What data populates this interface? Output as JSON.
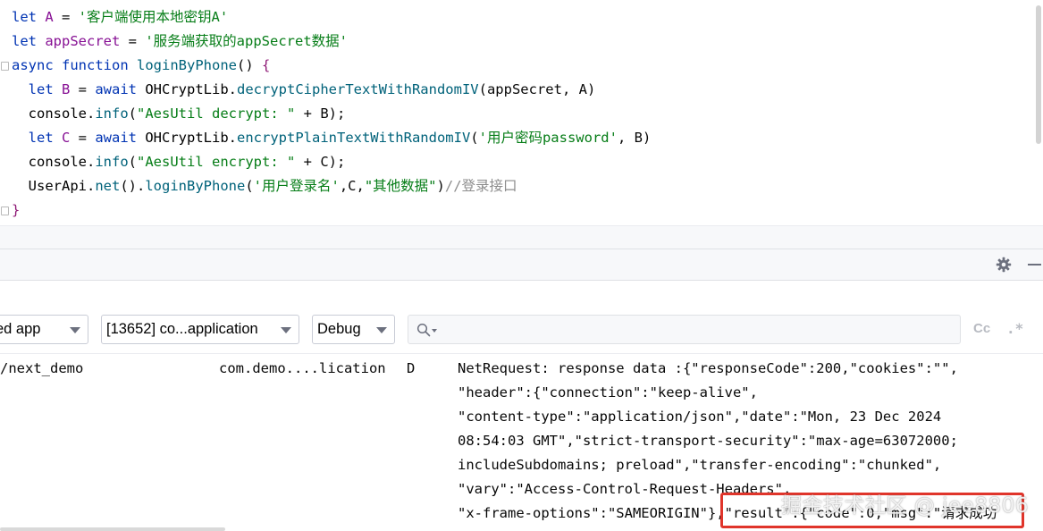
{
  "editor": {
    "lines": [
      [
        {
          "t": "let",
          "c": "kw"
        },
        {
          "t": " A ",
          "c": "var"
        },
        {
          "t": "= ",
          "c": "plain"
        },
        {
          "t": "'客户端使用本地密钥A'",
          "c": "str"
        }
      ],
      [
        {
          "t": "let",
          "c": "kw"
        },
        {
          "t": " appSecret ",
          "c": "var"
        },
        {
          "t": "= ",
          "c": "plain"
        },
        {
          "t": "'服务端获取的appSecret数据'",
          "c": "str"
        }
      ],
      [
        {
          "t": "async",
          "c": "kw"
        },
        {
          "t": " ",
          "c": "plain"
        },
        {
          "t": "function",
          "c": "kw"
        },
        {
          "t": " ",
          "c": "plain"
        },
        {
          "t": "loginByPhone",
          "c": "fn"
        },
        {
          "t": "() ",
          "c": "plain"
        },
        {
          "t": "{",
          "c": "kw-mod"
        }
      ],
      [
        {
          "t": "  ",
          "c": "plain"
        },
        {
          "t": "let",
          "c": "kw"
        },
        {
          "t": " B ",
          "c": "var"
        },
        {
          "t": "= ",
          "c": "plain"
        },
        {
          "t": "await",
          "c": "kw"
        },
        {
          "t": " OHCryptLib.",
          "c": "cls"
        },
        {
          "t": "decryptCipherTextWithRandomIV",
          "c": "method"
        },
        {
          "t": "(appSecret, A)",
          "c": "plain"
        }
      ],
      [
        {
          "t": "  ",
          "c": "plain"
        },
        {
          "t": "console",
          "c": "obj"
        },
        {
          "t": ".",
          "c": "plain"
        },
        {
          "t": "info",
          "c": "method"
        },
        {
          "t": "(",
          "c": "plain"
        },
        {
          "t": "\"AesUtil decrypt: \"",
          "c": "str"
        },
        {
          "t": " + B);",
          "c": "plain"
        }
      ],
      [
        {
          "t": "  ",
          "c": "plain"
        },
        {
          "t": "let",
          "c": "kw"
        },
        {
          "t": " C ",
          "c": "var"
        },
        {
          "t": "= ",
          "c": "plain"
        },
        {
          "t": "await",
          "c": "kw"
        },
        {
          "t": " OHCryptLib.",
          "c": "cls"
        },
        {
          "t": "encryptPlainTextWithRandomIV",
          "c": "method"
        },
        {
          "t": "(",
          "c": "plain"
        },
        {
          "t": "'用户密码password'",
          "c": "str"
        },
        {
          "t": ", B)",
          "c": "plain"
        }
      ],
      [
        {
          "t": "  ",
          "c": "plain"
        },
        {
          "t": "console",
          "c": "obj"
        },
        {
          "t": ".",
          "c": "plain"
        },
        {
          "t": "info",
          "c": "method"
        },
        {
          "t": "(",
          "c": "plain"
        },
        {
          "t": "\"AesUtil encrypt: \"",
          "c": "str"
        },
        {
          "t": " + C);",
          "c": "plain"
        }
      ],
      [
        {
          "t": "  ",
          "c": "plain"
        },
        {
          "t": "UserApi",
          "c": "cls"
        },
        {
          "t": ".",
          "c": "plain"
        },
        {
          "t": "net",
          "c": "method"
        },
        {
          "t": "().",
          "c": "plain"
        },
        {
          "t": "loginByPhone",
          "c": "method"
        },
        {
          "t": "(",
          "c": "plain"
        },
        {
          "t": "'用户登录名'",
          "c": "str"
        },
        {
          "t": ",C,",
          "c": "plain"
        },
        {
          "t": "\"其他数据\"",
          "c": "str"
        },
        {
          "t": ")",
          "c": "plain"
        },
        {
          "t": "//登录接口",
          "c": "comment"
        }
      ],
      [
        {
          "t": "}",
          "c": "kw-mod"
        }
      ]
    ]
  },
  "toolbar": {
    "device_label": "ed app",
    "process_label": "[13652] co...application",
    "level_label": "Debug",
    "search_placeholder": "",
    "match_case_label": "Cc",
    "regex_label": ".*"
  },
  "log": {
    "tag": "/next_demo",
    "package": "com.demo....lication",
    "level": "D",
    "message_lines": [
      "NetRequest: response data :{\"responseCode\":200,\"cookies\":\"\",",
      "\"header\":{\"connection\":\"keep-alive\",",
      "\"content-type\":\"application/json\",\"date\":\"Mon, 23 Dec 2024",
      "08:54:03 GMT\",\"strict-transport-security\":\"max-age=63072000;",
      "includeSubdomains; preload\",\"transfer-encoding\":\"chunked\",",
      "\"vary\":\"Access-Control-Request-Headers\",",
      "\"x-frame-options\":\"SAMEORIGIN\"},\"result\":{\"code\":0,\"msg\":\"请求成功"
    ]
  },
  "watermark": "掘金技术社区 @ jee8806",
  "colors": {
    "highlight_box": "#e0352b",
    "keyword": "#0033b3",
    "string": "#067d17",
    "function": "#00627a"
  }
}
